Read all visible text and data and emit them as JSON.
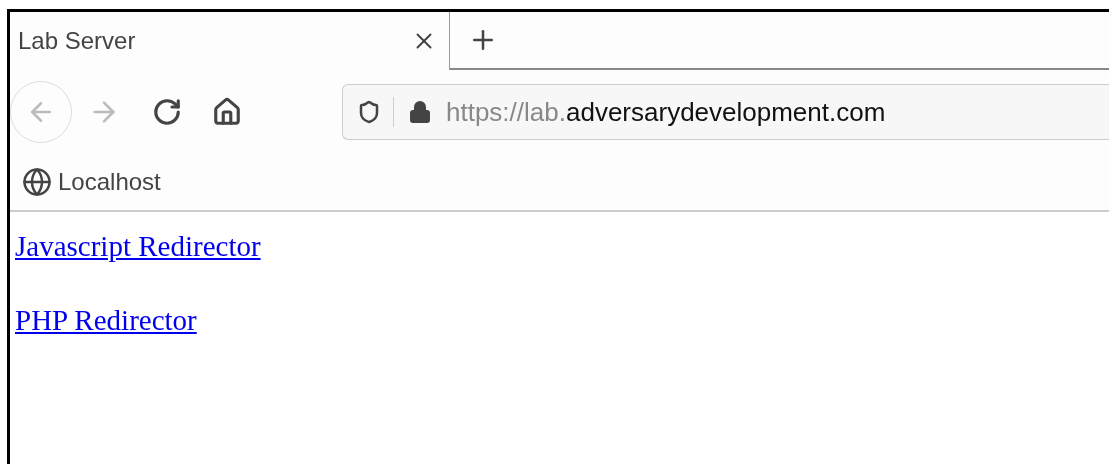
{
  "tab": {
    "title": "Lab Server",
    "selected": true
  },
  "address_bar": {
    "url_prefix": "https://lab.",
    "url_domain": "adversarydevelopment.com"
  },
  "bookmarks": [
    {
      "label": "Localhost"
    }
  ],
  "links": [
    {
      "label": "Javascript Redirector"
    },
    {
      "label": "PHP Redirector"
    }
  ]
}
